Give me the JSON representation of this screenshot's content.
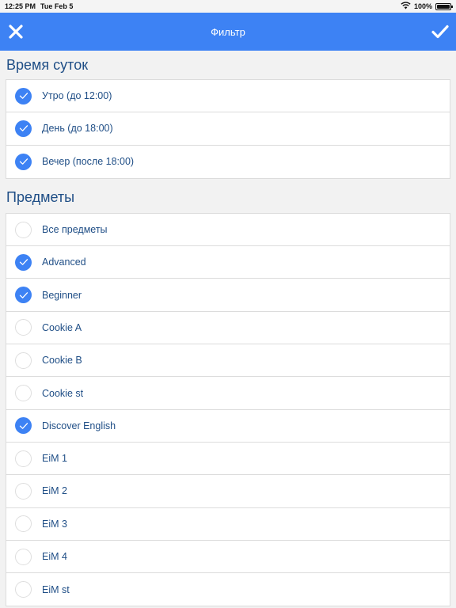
{
  "status_bar": {
    "time": "12:25 PM",
    "date": "Tue Feb 5",
    "battery": "100%",
    "battery_level": 1.0,
    "icons": [
      "wifi-icon",
      "battery-icon"
    ]
  },
  "nav": {
    "title": "Фильтр",
    "close_icon": "close-icon",
    "confirm_icon": "checkmark-icon",
    "color": "#3d82f4"
  },
  "sections": {
    "time_of_day": {
      "title": "Время суток",
      "items": [
        {
          "label": "Утро (до 12:00)",
          "checked": true
        },
        {
          "label": "День (до 18:00)",
          "checked": true
        },
        {
          "label": "Вечер (после 18:00)",
          "checked": true
        }
      ]
    },
    "subjects": {
      "title": "Предметы",
      "items": [
        {
          "label": "Все предметы",
          "checked": false
        },
        {
          "label": "Advanced",
          "checked": true
        },
        {
          "label": "Beginner",
          "checked": true
        },
        {
          "label": "Cookie A",
          "checked": false
        },
        {
          "label": "Cookie B",
          "checked": false
        },
        {
          "label": "Cookie st",
          "checked": false
        },
        {
          "label": "Discover English",
          "checked": true
        },
        {
          "label": "EiM 1",
          "checked": false
        },
        {
          "label": "EiM 2",
          "checked": false
        },
        {
          "label": "EiM 3",
          "checked": false
        },
        {
          "label": "EiM 4",
          "checked": false
        },
        {
          "label": "EiM st",
          "checked": false
        }
      ]
    }
  }
}
